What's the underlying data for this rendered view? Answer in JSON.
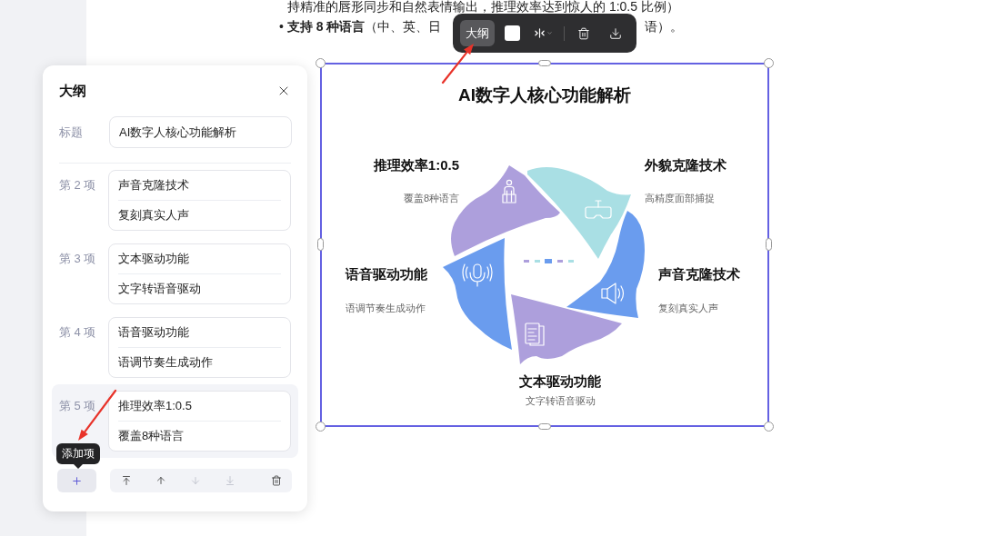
{
  "document": {
    "line": "持精准的唇形同步和自然表情输出，推理效率达到惊人的 1:0.5 比例）",
    "bullet": {
      "before": "• **支持 8 种语言**（中、英、日",
      "after": "语）。"
    }
  },
  "toolbar": {
    "outline_button": {
      "label": "大纲",
      "selected": true
    },
    "fill_swatch": {
      "color": "#ffffff"
    }
  },
  "outline_panel": {
    "title": "大纲",
    "title_field": {
      "label": "标题",
      "value": "AI数字人核心功能解析"
    },
    "items": [
      {
        "label": "第 2 项",
        "title": "声音克隆技术",
        "subtitle": "复刻真实人声",
        "selected": false
      },
      {
        "label": "第 3 项",
        "title": "文本驱动功能",
        "subtitle": "文字转语音驱动",
        "selected": false
      },
      {
        "label": "第 4 项",
        "title": "语音驱动功能",
        "subtitle": "语调节奏生成动作",
        "selected": false
      },
      {
        "label": "第 5 项",
        "title": "推理效率1:0.5",
        "subtitle": "覆盖8种语言",
        "selected": true
      }
    ],
    "add_tooltip": "添加项",
    "actions": [
      {
        "kind": "top",
        "disabled": false
      },
      {
        "kind": "up",
        "disabled": false
      },
      {
        "kind": "down",
        "disabled": true
      },
      {
        "kind": "bottom",
        "disabled": true
      },
      {
        "kind": "delete",
        "disabled": false
      }
    ]
  },
  "diagram": {
    "title": "AI数字人核心功能解析",
    "segments": [
      {
        "kind": "efficiency",
        "title": "推理效率1:0.5",
        "desc": "覆盖8种语言",
        "color": "#ad9fdc"
      },
      {
        "kind": "appearance",
        "title": "外貌克隆技术",
        "desc": "高精度面部捕捉",
        "color": "#a9dfe4"
      },
      {
        "kind": "speech",
        "title": "语音驱动功能",
        "desc": "语调节奏生成动作",
        "color": "#6a9cee"
      },
      {
        "kind": "voice",
        "title": "声音克隆技术",
        "desc": "复刻真实人声",
        "color": "#6a9cee"
      },
      {
        "kind": "text",
        "title": "文本驱动功能",
        "desc": "文字转语音驱动",
        "color": "#ad9fdc"
      }
    ]
  }
}
